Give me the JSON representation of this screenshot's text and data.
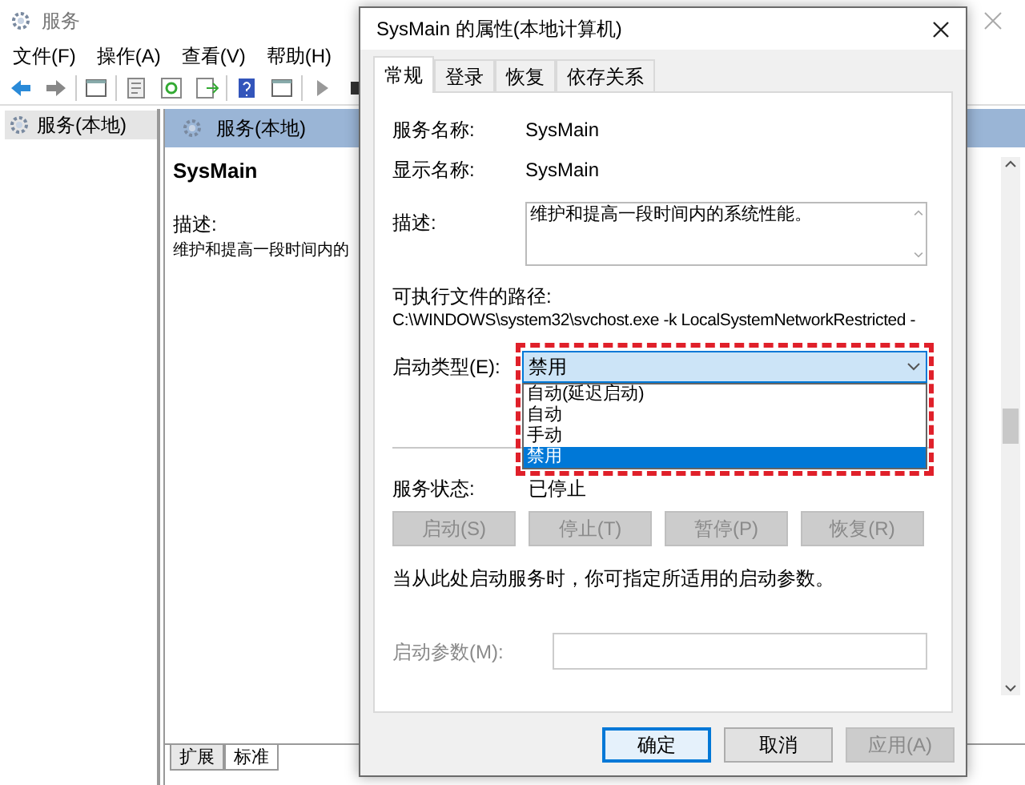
{
  "background_window": {
    "title": "服务",
    "menu": [
      "文件(F)",
      "操作(A)",
      "查看(V)",
      "帮助(H)"
    ],
    "tree": [
      {
        "label": "服务(本地)",
        "selected": true
      }
    ],
    "pane": {
      "header": "服务(本地)",
      "service_name": "SysMain",
      "description_label": "描述:",
      "description": "维护和提高一段时间内的"
    },
    "bottom_tabs": [
      {
        "label": "扩展",
        "selected": false
      },
      {
        "label": "标准",
        "selected": true
      }
    ]
  },
  "dialog": {
    "title": "SysMain 的属性(本地计算机)",
    "tabs": [
      {
        "label": "常规",
        "selected": true
      },
      {
        "label": "登录",
        "selected": false
      },
      {
        "label": "恢复",
        "selected": false
      },
      {
        "label": "依存关系",
        "selected": false
      }
    ],
    "service_name": {
      "label": "服务名称:",
      "value": "SysMain"
    },
    "display_name": {
      "label": "显示名称:",
      "value": "SysMain"
    },
    "description": {
      "label": "描述:",
      "value": "维护和提高一段时间内的系统性能。"
    },
    "path": {
      "label": "可执行文件的路径:",
      "value": "C:\\WINDOWS\\system32\\svchost.exe -k LocalSystemNetworkRestricted -"
    },
    "startup_type": {
      "label": "启动类型(E):",
      "value": "禁用",
      "expanded": true,
      "highlighted": true,
      "options": [
        {
          "label": "自动(延迟启动)",
          "selected": false
        },
        {
          "label": "自动",
          "selected": false
        },
        {
          "label": "手动",
          "selected": false
        },
        {
          "label": "禁用",
          "selected": true
        }
      ]
    },
    "status": {
      "label": "服务状态:",
      "value": "已停止"
    },
    "control_buttons": [
      {
        "label": "启动(S)",
        "disabled": true
      },
      {
        "label": "停止(T)",
        "disabled": true
      },
      {
        "label": "暂停(P)",
        "disabled": true
      },
      {
        "label": "恢复(R)",
        "disabled": true
      }
    ],
    "hint": "当从此处启动服务时，你可指定所适用的启动参数。",
    "start_params": {
      "label": "启动参数(M):",
      "disabled": true
    },
    "footer_buttons": [
      {
        "label": "确定",
        "default": true,
        "disabled": false
      },
      {
        "label": "取消",
        "default": false,
        "disabled": false
      },
      {
        "label": "应用(A)",
        "default": false,
        "disabled": true
      }
    ]
  }
}
